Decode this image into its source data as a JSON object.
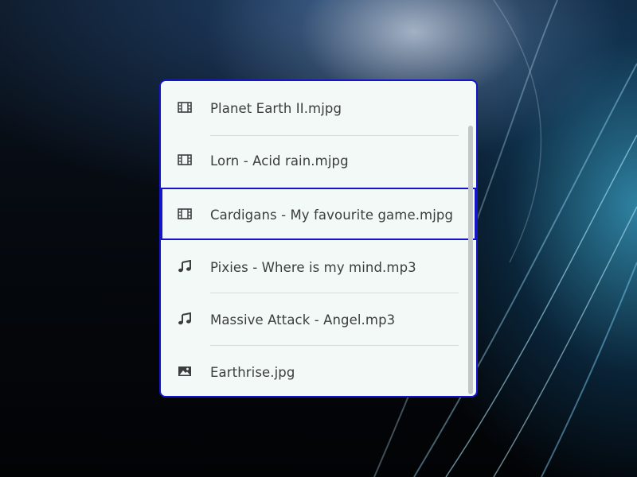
{
  "file_list": {
    "items": [
      {
        "name": "Planet Earth II.mjpg",
        "icon": "film-icon",
        "selected": false
      },
      {
        "name": "Lorn - Acid rain.mjpg",
        "icon": "film-icon",
        "selected": false
      },
      {
        "name": "Cardigans - My favourite game.mjpg",
        "icon": "film-icon",
        "selected": true
      },
      {
        "name": "Pixies - Where is my mind.mp3",
        "icon": "music-note-icon",
        "selected": false
      },
      {
        "name": "Massive Attack - Angel.mp3",
        "icon": "music-note-icon",
        "selected": false
      },
      {
        "name": "Earthrise.jpg",
        "icon": "image-icon",
        "selected": false
      }
    ]
  },
  "colors": {
    "accent": "#1414c8",
    "list_background": "#f3f9f7",
    "text": "#3b3d3f",
    "divider": "#d8dcdb",
    "scrollbar": "#c3c6c6"
  }
}
